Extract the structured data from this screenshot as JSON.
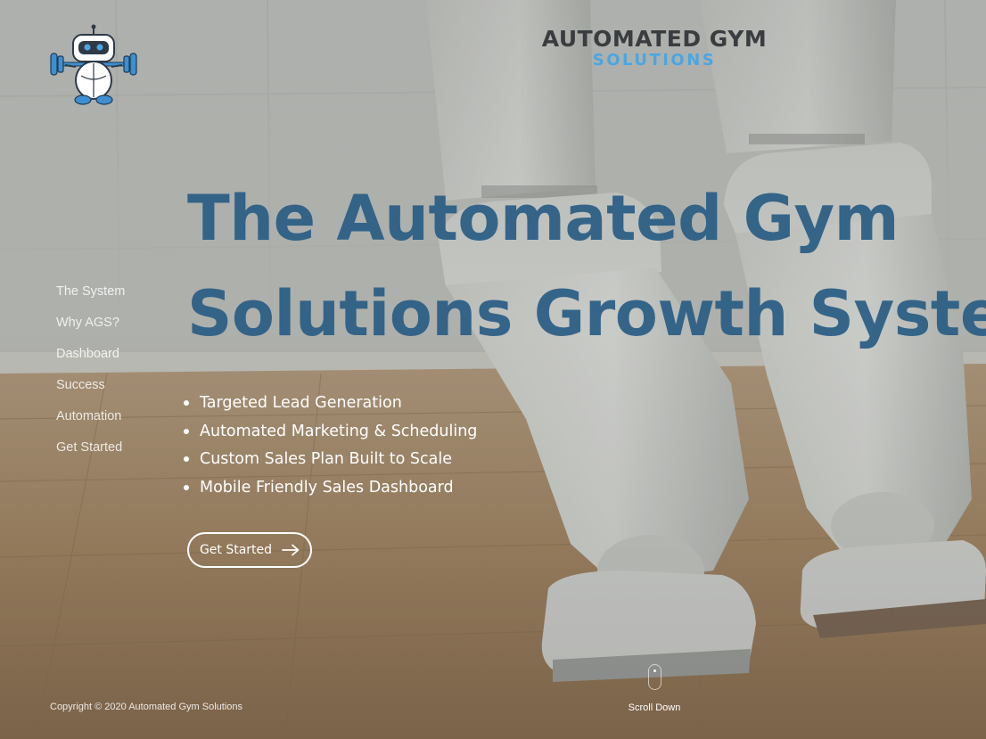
{
  "brand": {
    "line1": "AUTOMATED GYM",
    "line2": "SOLUTIONS",
    "primary_color": "#2a5e85",
    "accent_color": "#4aa6e3",
    "mascot_icon": "robot-lifting-dumbbell"
  },
  "nav": {
    "items": [
      {
        "label": "The System"
      },
      {
        "label": "Why AGS?"
      },
      {
        "label": "Dashboard"
      },
      {
        "label": "Success"
      },
      {
        "label": "Automation"
      },
      {
        "label": "Get Started"
      }
    ]
  },
  "hero": {
    "title_line1": "The Automated Gym",
    "title_line2": "Solutions Growth System",
    "features": [
      {
        "text": "Targeted Lead Generation"
      },
      {
        "text": "Automated Marketing & Scheduling"
      },
      {
        "text": "Custom Sales Plan Built to Scale"
      },
      {
        "text": "Mobile Friendly Sales Dashboard"
      }
    ],
    "cta_label": "Get Started",
    "cta_icon": "arrow-right-icon"
  },
  "footer": {
    "copyright": "Copyright © 2020 Automated Gym Solutions",
    "scroll_label": "Scroll Down",
    "scroll_icon": "mouse-icon"
  }
}
